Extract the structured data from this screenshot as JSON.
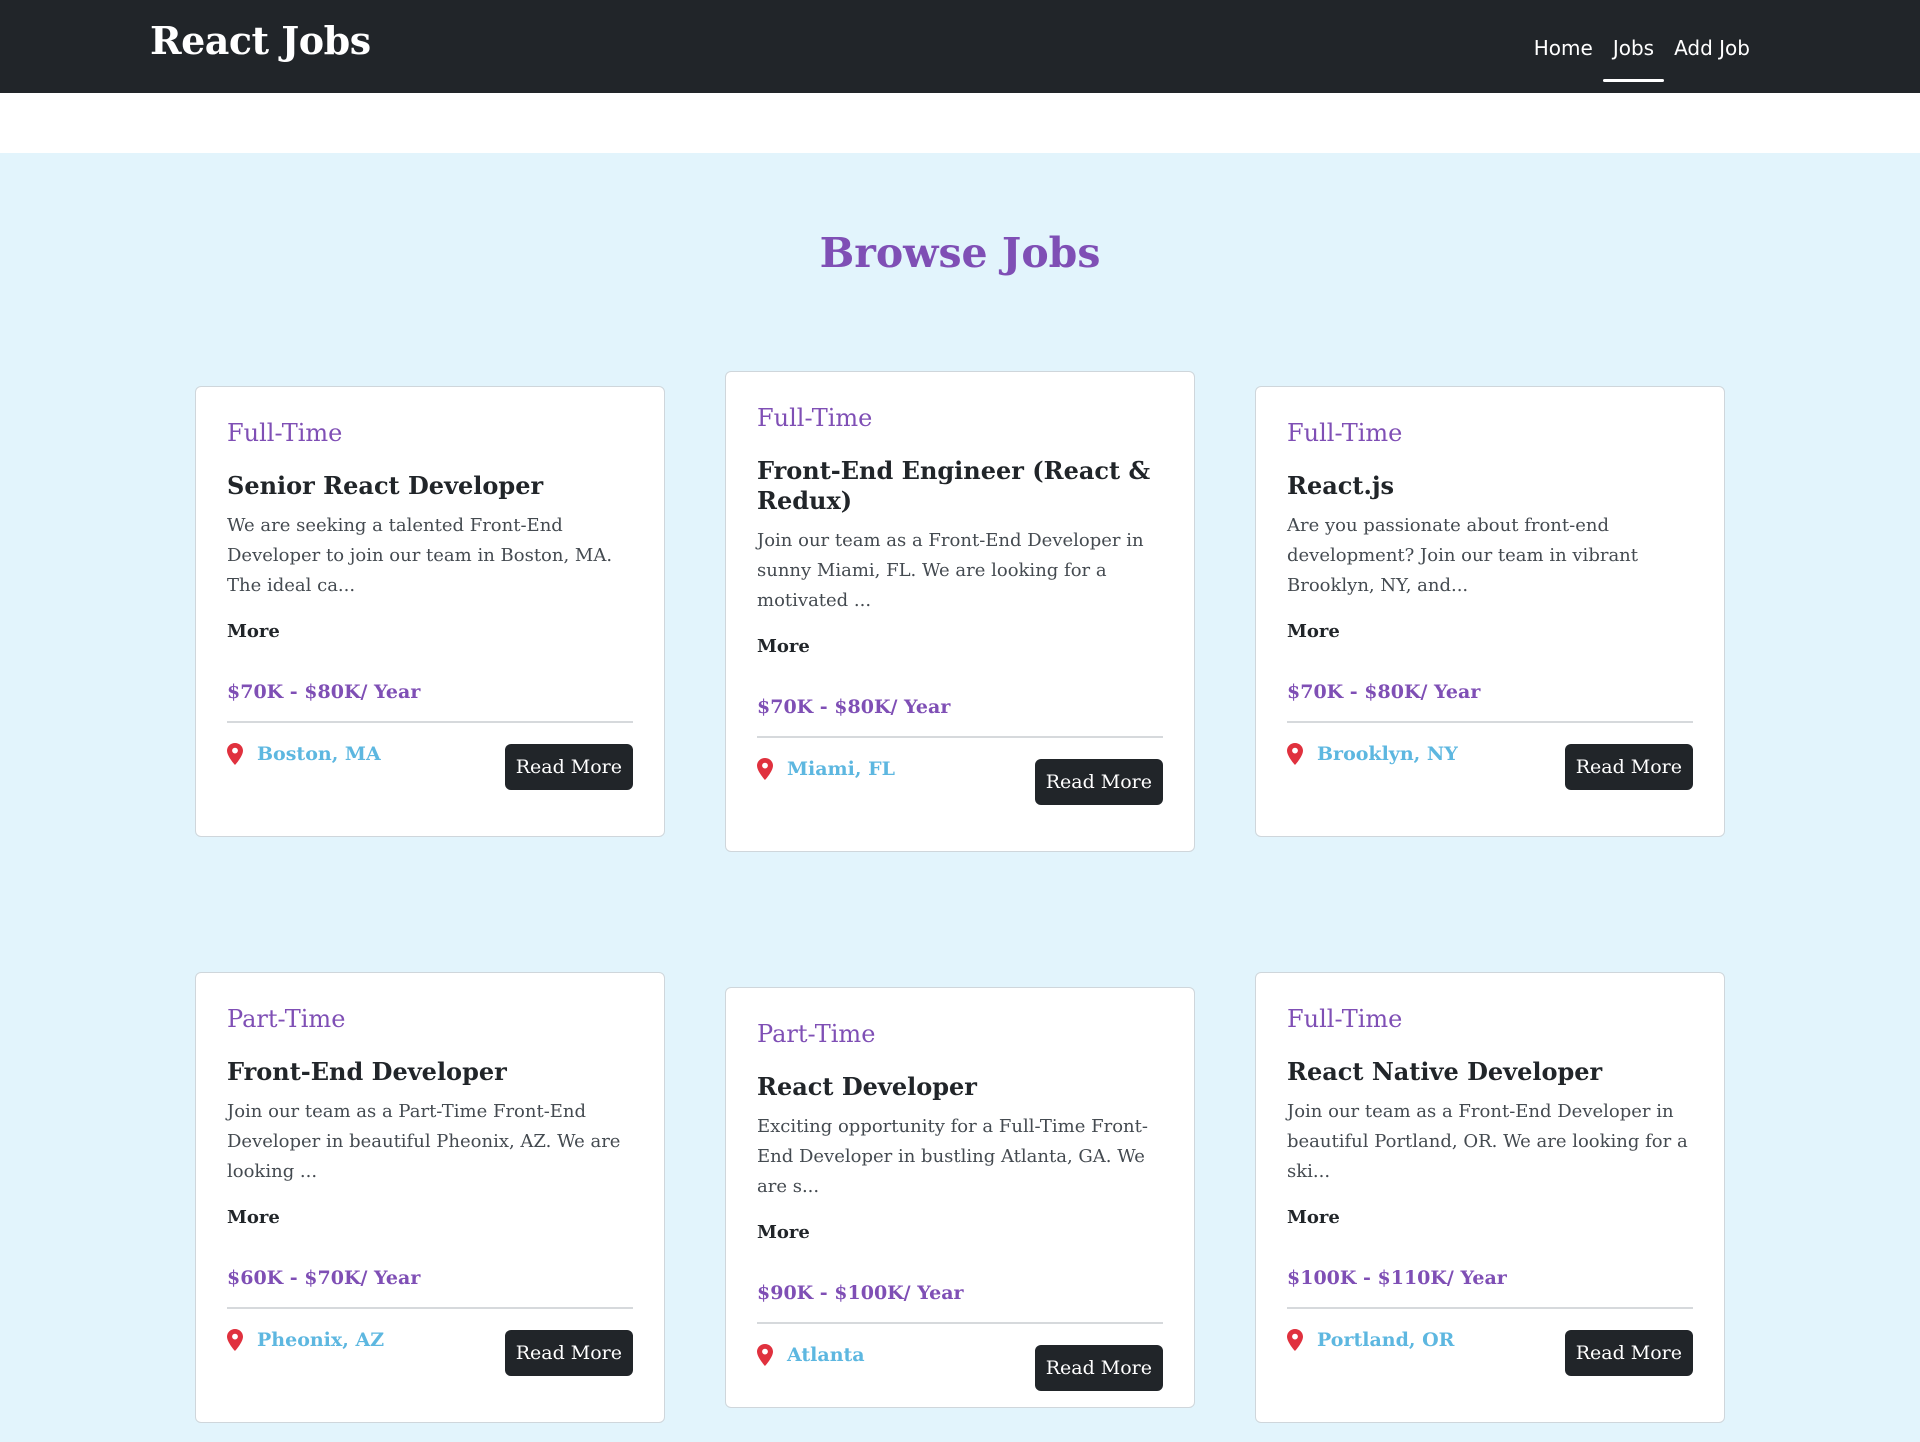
{
  "header": {
    "brand": "React Jobs",
    "nav": [
      {
        "label": "Home",
        "active": false
      },
      {
        "label": "Jobs",
        "active": true
      },
      {
        "label": "Add Job",
        "active": false
      }
    ]
  },
  "main": {
    "title": "Browse Jobs",
    "jobs": [
      {
        "type": "Full-Time",
        "title": "Senior React Developer",
        "description": "We are seeking a talented Front-End Developer to join our team in Boston, MA. The ideal ca...",
        "more_label": "More",
        "salary": "$70K - $80K/ Year",
        "location": "Boston, MA",
        "button_label": "Read More"
      },
      {
        "type": "Full-Time",
        "title": "Front-End Engineer (React & Redux)",
        "description": "Join our team as a Front-End Developer in sunny Miami, FL. We are looking for a motivated ...",
        "more_label": "More",
        "salary": "$70K - $80K/ Year",
        "location": "Miami, FL",
        "button_label": "Read More"
      },
      {
        "type": "Full-Time",
        "title": "React.js",
        "description": "Are you passionate about front-end development? Join our team in vibrant Brooklyn, NY, and...",
        "more_label": "More",
        "salary": "$70K - $80K/ Year",
        "location": "Brooklyn, NY",
        "button_label": "Read More"
      },
      {
        "type": "Part-Time",
        "title": "Front-End Developer",
        "description": "Join our team as a Part-Time Front-End Developer in beautiful Pheonix, AZ. We are looking ...",
        "more_label": "More",
        "salary": "$60K - $70K/ Year",
        "location": "Pheonix, AZ",
        "button_label": "Read More"
      },
      {
        "type": "Part-Time",
        "title": "React Developer",
        "description": "Exciting opportunity for a Full-Time Front-End Developer in bustling Atlanta, GA. We are s...",
        "more_label": "More",
        "salary": "$90K - $100K/ Year",
        "location": "Atlanta",
        "button_label": "Read More"
      },
      {
        "type": "Full-Time",
        "title": "React Native Developer",
        "description": "Join our team as a Front-End Developer in beautiful Portland, OR. We are looking for a ski...",
        "more_label": "More",
        "salary": "$100K - $110K/ Year",
        "location": "Portland, OR",
        "button_label": "Read More"
      }
    ]
  },
  "colors": {
    "navbar_bg": "#212529",
    "page_bg": "#e2f4fc",
    "accent_purple": "#7f4fb5",
    "location_blue": "#5db7e0",
    "pin_red": "#e0313e"
  },
  "icons": {
    "location": "map-pin-icon"
  }
}
